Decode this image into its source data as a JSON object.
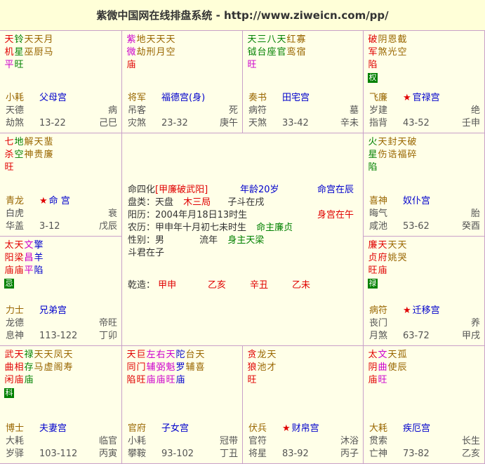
{
  "header": {
    "title": "紫微中国网在线排盘系统 - http://www.ziweicn.com/pp/"
  },
  "palaces": {
    "si": {
      "stars": [
        [
          "天",
          "机",
          "平"
        ],
        [
          "铃",
          "星",
          "旺"
        ],
        [
          "天",
          "巫",
          ""
        ],
        [
          "天",
          "厨",
          ""
        ],
        [
          "月",
          "马",
          ""
        ]
      ],
      "row1": [
        "小耗",
        "父母宫",
        ""
      ],
      "row2": [
        "天德",
        "",
        "病"
      ],
      "row3": [
        "劫煞",
        "13-22",
        "己巳"
      ]
    },
    "wu": {
      "stars": [
        [
          "紫",
          "微",
          "庙"
        ],
        [
          "地",
          "劫",
          ""
        ],
        [
          "天",
          "刑",
          ""
        ],
        [
          "天",
          "月",
          ""
        ],
        [
          "天",
          "空",
          ""
        ]
      ],
      "row1": [
        "将军",
        "福德宫(身)",
        ""
      ],
      "row2": [
        "吊客",
        "",
        "死"
      ],
      "row3": [
        "灾煞",
        "23-32",
        "庚午"
      ]
    },
    "wei": {
      "stars": [
        [
          "天",
          "钺",
          "旺"
        ],
        [
          "三",
          "台",
          ""
        ],
        [
          "八",
          "座",
          ""
        ],
        [
          "天",
          "官",
          ""
        ],
        [
          "红",
          "鸾",
          ""
        ],
        [
          "寡",
          "宿",
          ""
        ]
      ],
      "row1": [
        "奏书",
        "田宅宫",
        ""
      ],
      "row2": [
        "病符",
        "",
        "墓"
      ],
      "row3": [
        "天煞",
        "33-42",
        "辛未"
      ]
    },
    "shen": {
      "stars": [
        [
          "破",
          "军",
          "陷"
        ],
        [
          "阴",
          "煞",
          ""
        ],
        [
          "恩",
          "光",
          ""
        ],
        [
          "截",
          "空",
          ""
        ]
      ],
      "hua": "权",
      "row1": [
        "飞廉",
        "官禄宫",
        ""
      ],
      "row2": [
        "岁建",
        "",
        "绝"
      ],
      "row3": [
        "指背",
        "43-52",
        "壬申"
      ]
    },
    "chen": {
      "stars": [
        [
          "七",
          "杀",
          "旺"
        ],
        [
          "地",
          "空",
          ""
        ],
        [
          "解",
          "神",
          ""
        ],
        [
          "天",
          "贵",
          ""
        ],
        [
          "蜚",
          "廉",
          ""
        ]
      ],
      "row1": [
        "青龙",
        "命 宫",
        ""
      ],
      "row2": [
        "白虎",
        "",
        "衰"
      ],
      "row3": [
        "华盖",
        "3-12",
        "戊辰"
      ]
    },
    "you": {
      "stars": [
        [
          "火",
          "星",
          "陷"
        ],
        [
          "天",
          "伤",
          ""
        ],
        [
          "封",
          "诰",
          ""
        ],
        [
          "天",
          "福",
          ""
        ],
        [
          "破",
          "碎",
          ""
        ]
      ],
      "row1": [
        "喜神",
        "奴仆宫",
        ""
      ],
      "row2": [
        "晦气",
        "",
        "胎"
      ],
      "row3": [
        "咸池",
        "53-62",
        "癸酉"
      ]
    },
    "mao": {
      "stars": [
        [
          "太",
          "阳",
          "庙"
        ],
        [
          "天",
          "梁",
          "庙"
        ],
        [
          "文",
          "昌",
          "平"
        ],
        [
          "擎",
          "羊",
          "陷"
        ]
      ],
      "hua": "忌",
      "row1": [
        "力士",
        "兄弟宫",
        ""
      ],
      "row2": [
        "龙德",
        "",
        "帝旺"
      ],
      "row3": [
        "息神",
        "113-122",
        "丁卯"
      ]
    },
    "xu": {
      "stars": [
        [
          "廉",
          "贞",
          "旺"
        ],
        [
          "天",
          "府",
          "庙"
        ],
        [
          "天",
          "姚",
          ""
        ],
        [
          "天",
          "哭",
          ""
        ]
      ],
      "hua": "禄",
      "row1": [
        "病符",
        "迁移宫",
        ""
      ],
      "row2": [
        "丧门",
        "",
        "养"
      ],
      "row3": [
        "月煞",
        "63-72",
        "甲戌"
      ]
    },
    "yin": {
      "stars": [
        [
          "武",
          "曲",
          "闲"
        ],
        [
          "天",
          "相",
          "庙"
        ],
        [
          "禄",
          "存",
          "庙"
        ],
        [
          "天",
          "马",
          ""
        ],
        [
          "天",
          "虚",
          ""
        ],
        [
          "凤",
          "阁",
          ""
        ],
        [
          "天",
          "寿",
          ""
        ]
      ],
      "hua": "科",
      "row1": [
        "博士",
        "夫妻宫",
        ""
      ],
      "row2": [
        "大耗",
        "",
        "临官"
      ],
      "row3": [
        "岁驿",
        "103-112",
        "丙寅"
      ]
    },
    "chou": {
      "stars": [
        [
          "天",
          "同",
          "陷"
        ],
        [
          "巨",
          "门",
          "旺"
        ],
        [
          "左",
          "辅",
          "庙"
        ],
        [
          "右",
          "弼",
          "庙"
        ],
        [
          "天",
          "魁",
          "旺"
        ],
        [
          "陀",
          "罗",
          "庙"
        ],
        [
          "台",
          "辅",
          ""
        ],
        [
          "天",
          "喜",
          ""
        ]
      ],
      "row1": [
        "官府",
        "子女宫",
        ""
      ],
      "row2": [
        "小耗",
        "",
        "冠带"
      ],
      "row3": [
        "攀鞍",
        "93-102",
        "丁丑"
      ]
    },
    "zi": {
      "stars": [
        [
          "贪",
          "狼",
          "旺"
        ],
        [
          "龙",
          "池",
          ""
        ],
        [
          "天",
          "才",
          ""
        ]
      ],
      "row1": [
        "伏兵",
        "财帛宫",
        ""
      ],
      "row2": [
        "官符",
        "",
        "沐浴"
      ],
      "row3": [
        "将星",
        "83-92",
        "丙子"
      ]
    },
    "hai": {
      "stars": [
        [
          "太",
          "阴",
          "庙"
        ],
        [
          "文",
          "曲",
          "旺"
        ],
        [
          "天",
          "使",
          ""
        ],
        [
          "孤",
          "辰",
          ""
        ]
      ],
      "row1": [
        "大耗",
        "疾厄宫",
        ""
      ],
      "row2": [
        "贯索",
        "",
        "长生"
      ],
      "row3": [
        "亡神",
        "73-82",
        "乙亥"
      ]
    }
  },
  "center": {
    "line1": [
      "命四化",
      "[甲廉破武阳]",
      "年龄20岁",
      "命宫在辰"
    ],
    "line2": [
      "盘类：天盘",
      "木三局",
      "子斗在戌"
    ],
    "line3": [
      "阳历：2004年月18日13时生",
      "身宫在午"
    ],
    "line4": [
      "农历：甲申年十月初七未时生",
      "命主廉贞"
    ],
    "line5": [
      "性别：男",
      "流年",
      "身主天梁"
    ],
    "line6": [
      "斗君在子"
    ],
    "line7": [
      "乾造：",
      "甲申",
      "乙亥",
      "辛丑",
      "乙未"
    ]
  }
}
